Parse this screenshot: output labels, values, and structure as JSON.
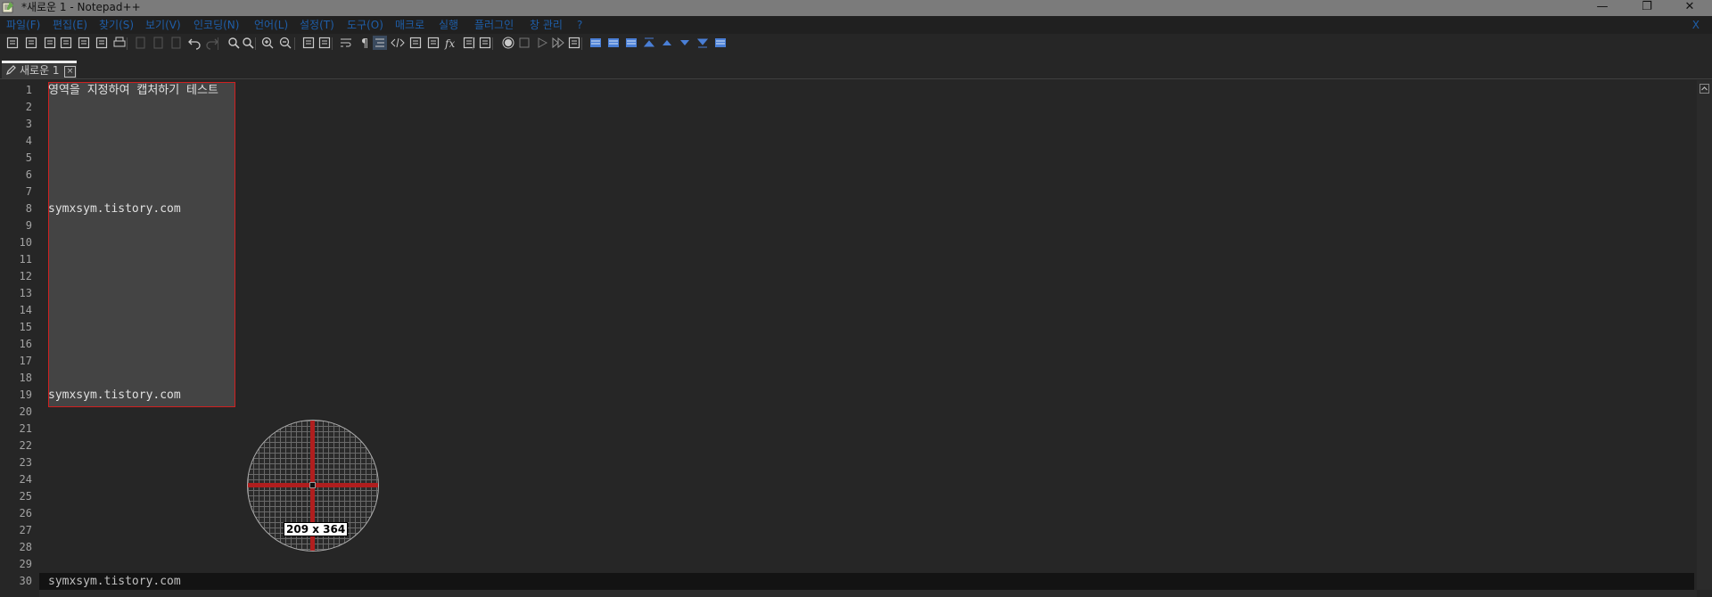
{
  "window": {
    "title": "*새로운 1 - Notepad++",
    "minimize_glyph": "—",
    "restore_glyph": "❐",
    "close_glyph": "✕"
  },
  "menu": {
    "items": [
      "파일(F)",
      "편집(E)",
      "찾기(S)",
      "보기(V)",
      "인코딩(N)",
      "언어(L)",
      "설정(T)",
      "도구(O)",
      "매크로",
      "실행",
      "플러그인",
      "창 관리",
      "?"
    ],
    "close_label": "X",
    "color": "#1f5ea8"
  },
  "toolbar": {
    "icons": [
      "new-file-icon",
      "open-file-icon",
      "save-icon",
      "save-all-icon",
      "close-icon",
      "close-all-icon",
      "print-icon",
      "cut-icon",
      "copy-icon",
      "paste-icon",
      "undo-icon",
      "redo-icon",
      "find-icon",
      "replace-icon",
      "zoom-in-icon",
      "zoom-out-icon",
      "sync-vertical-icon",
      "sync-horizontal-icon",
      "word-wrap-icon",
      "show-all-chars-icon",
      "indent-guide-icon",
      "xml-tag-icon",
      "document-map-icon",
      "document-list-icon",
      "function-list-icon",
      "folder-as-workspace-icon",
      "monitoring-icon",
      "record-macro-icon",
      "stop-macro-icon",
      "play-macro-icon",
      "run-macro-multiple-icon",
      "save-macro-icon",
      "plugin-comment-icon",
      "plugin-table-icon",
      "plugin-table2-icon",
      "plugin-top-icon",
      "plugin-up-icon",
      "plugin-down-icon",
      "plugin-bottom-icon",
      "plugin-panel-icon"
    ]
  },
  "tab": {
    "label": "새로운 1",
    "close_glyph": "×"
  },
  "editor": {
    "line_numbers": [
      "1",
      "2",
      "3",
      "4",
      "5",
      "6",
      "7",
      "8",
      "9",
      "10",
      "11",
      "12",
      "13",
      "14",
      "15",
      "16",
      "17",
      "18",
      "19",
      "20",
      "21",
      "22",
      "23",
      "24",
      "25",
      "26",
      "27",
      "28",
      "29",
      "30"
    ],
    "lines": {
      "l1": "영역을 지정하여 캡처하기 테스트",
      "l8": "symxsym.tistory.com",
      "l19": "symxsym.tistory.com",
      "l30": "symxsym.tistory.com"
    }
  },
  "capture": {
    "size_label": "209 x 364",
    "selection_color": "#d02020"
  }
}
